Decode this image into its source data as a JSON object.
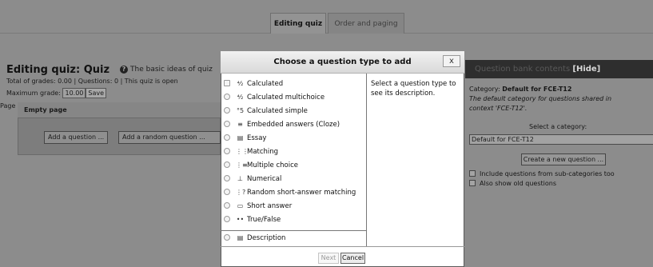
{
  "tabs": [
    {
      "label": "Editing quiz",
      "active": true
    },
    {
      "label": "Order and paging",
      "active": false
    }
  ],
  "quiz": {
    "title": "Editing quiz: Quiz",
    "help_text": "The basic ideas of quiz",
    "grades_line": "Total of grades: 0.00 | Questions: 0 | This quiz is open",
    "max_grade_label": "Maximum grade:",
    "max_grade_value": "10.00",
    "save_label": "Save",
    "page_label": "Page 1",
    "page_heading": "Empty page",
    "add_question_label": "Add a question ...",
    "add_random_label": "Add a random question ..."
  },
  "question_bank": {
    "header_label": "Question bank contents",
    "hide_label": "[Hide]",
    "category_prefix": "Category:",
    "category_name": "Default for FCE-T12",
    "category_desc_line1": "The default category for questions shared in",
    "category_desc_line2": "context 'FCE-T12'.",
    "select_label": "Select a category:",
    "select_value": "Default for FCE-T12",
    "create_label": "Create a new question ...",
    "include_sub_label": "Include questions from sub-categories too",
    "show_old_label": "Also show old questions"
  },
  "modal": {
    "title": "Choose a question type to add",
    "close_label": "x",
    "description": "Select a question type to see its description.",
    "options": [
      {
        "label": "Calculated",
        "icon": "calculated-icon",
        "glyph": "⁴⁄₂"
      },
      {
        "label": "Calculated multichoice",
        "icon": "calculated-multichoice-icon",
        "glyph": "⁴⁄₂"
      },
      {
        "label": "Calculated simple",
        "icon": "calculated-simple-icon",
        "glyph": "°5"
      },
      {
        "label": "Embedded answers (Cloze)",
        "icon": "cloze-icon",
        "glyph": "≡"
      },
      {
        "label": "Essay",
        "icon": "essay-icon",
        "glyph": "▤"
      },
      {
        "label": "Matching",
        "icon": "matching-icon",
        "glyph": "⋮⋮"
      },
      {
        "label": "Multiple choice",
        "icon": "multiple-choice-icon",
        "glyph": "⋮≡"
      },
      {
        "label": "Numerical",
        "icon": "numerical-icon",
        "glyph": "⊥"
      },
      {
        "label": "Random short-answer matching",
        "icon": "random-matching-icon",
        "glyph": "⋮?"
      },
      {
        "label": "Short answer",
        "icon": "short-answer-icon",
        "glyph": "▭"
      },
      {
        "label": "True/False",
        "icon": "true-false-icon",
        "glyph": "••"
      },
      {
        "label": "Description",
        "icon": "description-icon",
        "glyph": "▤"
      }
    ],
    "next_label": "Next",
    "cancel_label": "Cancel"
  }
}
